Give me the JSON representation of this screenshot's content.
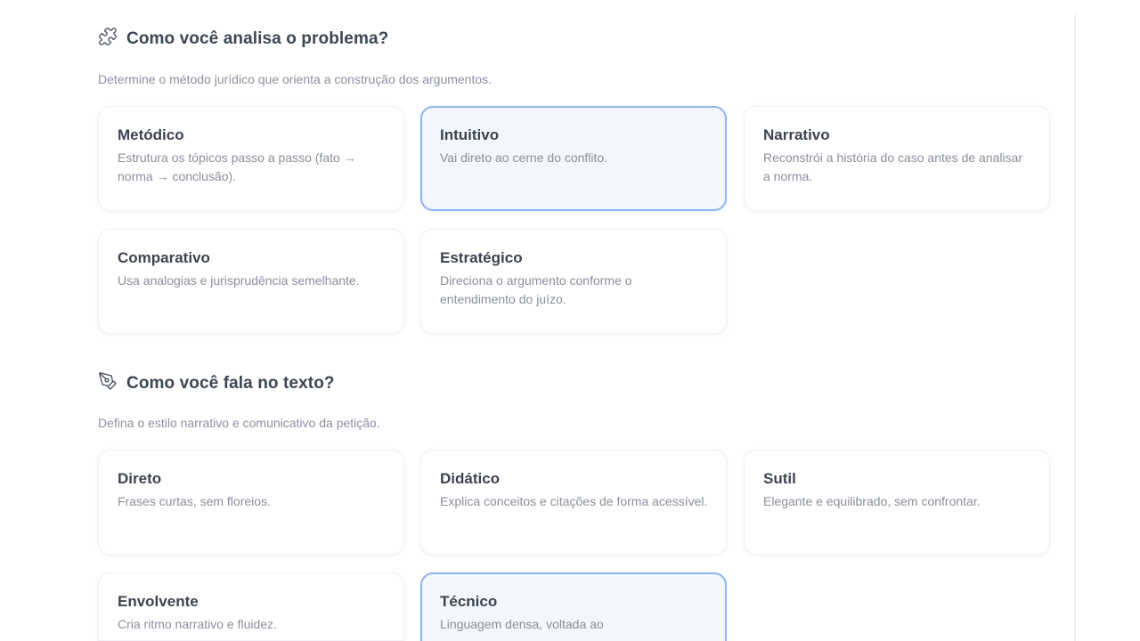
{
  "section1": {
    "title": "Como você analisa o problema?",
    "icon": "puzzle-icon",
    "description": "Determine o método jurídico que orienta a construção dos argumentos.",
    "options": [
      {
        "title": "Metódico",
        "desc": "Estrutura os tópicos passo a passo (fato → norma → conclusão).",
        "selected": false
      },
      {
        "title": "Intuitivo",
        "desc": "Vai direto ao cerne do conflito.",
        "selected": true
      },
      {
        "title": "Narrativo",
        "desc": "Reconstrói a história do caso antes de analisar a norma.",
        "selected": false
      },
      {
        "title": "Comparativo",
        "desc": "Usa analogias e jurisprudência semelhante.",
        "selected": false
      },
      {
        "title": "Estratégico",
        "desc": "Direciona o argumento conforme o entendimento do juízo.",
        "selected": false
      }
    ]
  },
  "section2": {
    "title": "Como você fala no texto?",
    "icon": "pen-tool-icon",
    "description": "Defina o estilo narrativo e comunicativo da petição.",
    "options": [
      {
        "title": "Direto",
        "desc": "Frases curtas, sem floreios.",
        "selected": false
      },
      {
        "title": "Didático",
        "desc": "Explica conceitos e citações de forma acessível.",
        "selected": false
      },
      {
        "title": "Sutil",
        "desc": "Elegante e equilibrado, sem confrontar.",
        "selected": false
      },
      {
        "title": "Envolvente",
        "desc": "Cria ritmo narrativo e fluidez.",
        "selected": false
      },
      {
        "title": "Técnico",
        "desc": "Linguagem densa, voltada ao",
        "selected": true
      }
    ]
  },
  "colors": {
    "selected_border": "#8fb5f0",
    "selected_bg": "#f2f6fd",
    "text_primary": "#3f4654",
    "text_secondary": "#8a8f9b"
  }
}
